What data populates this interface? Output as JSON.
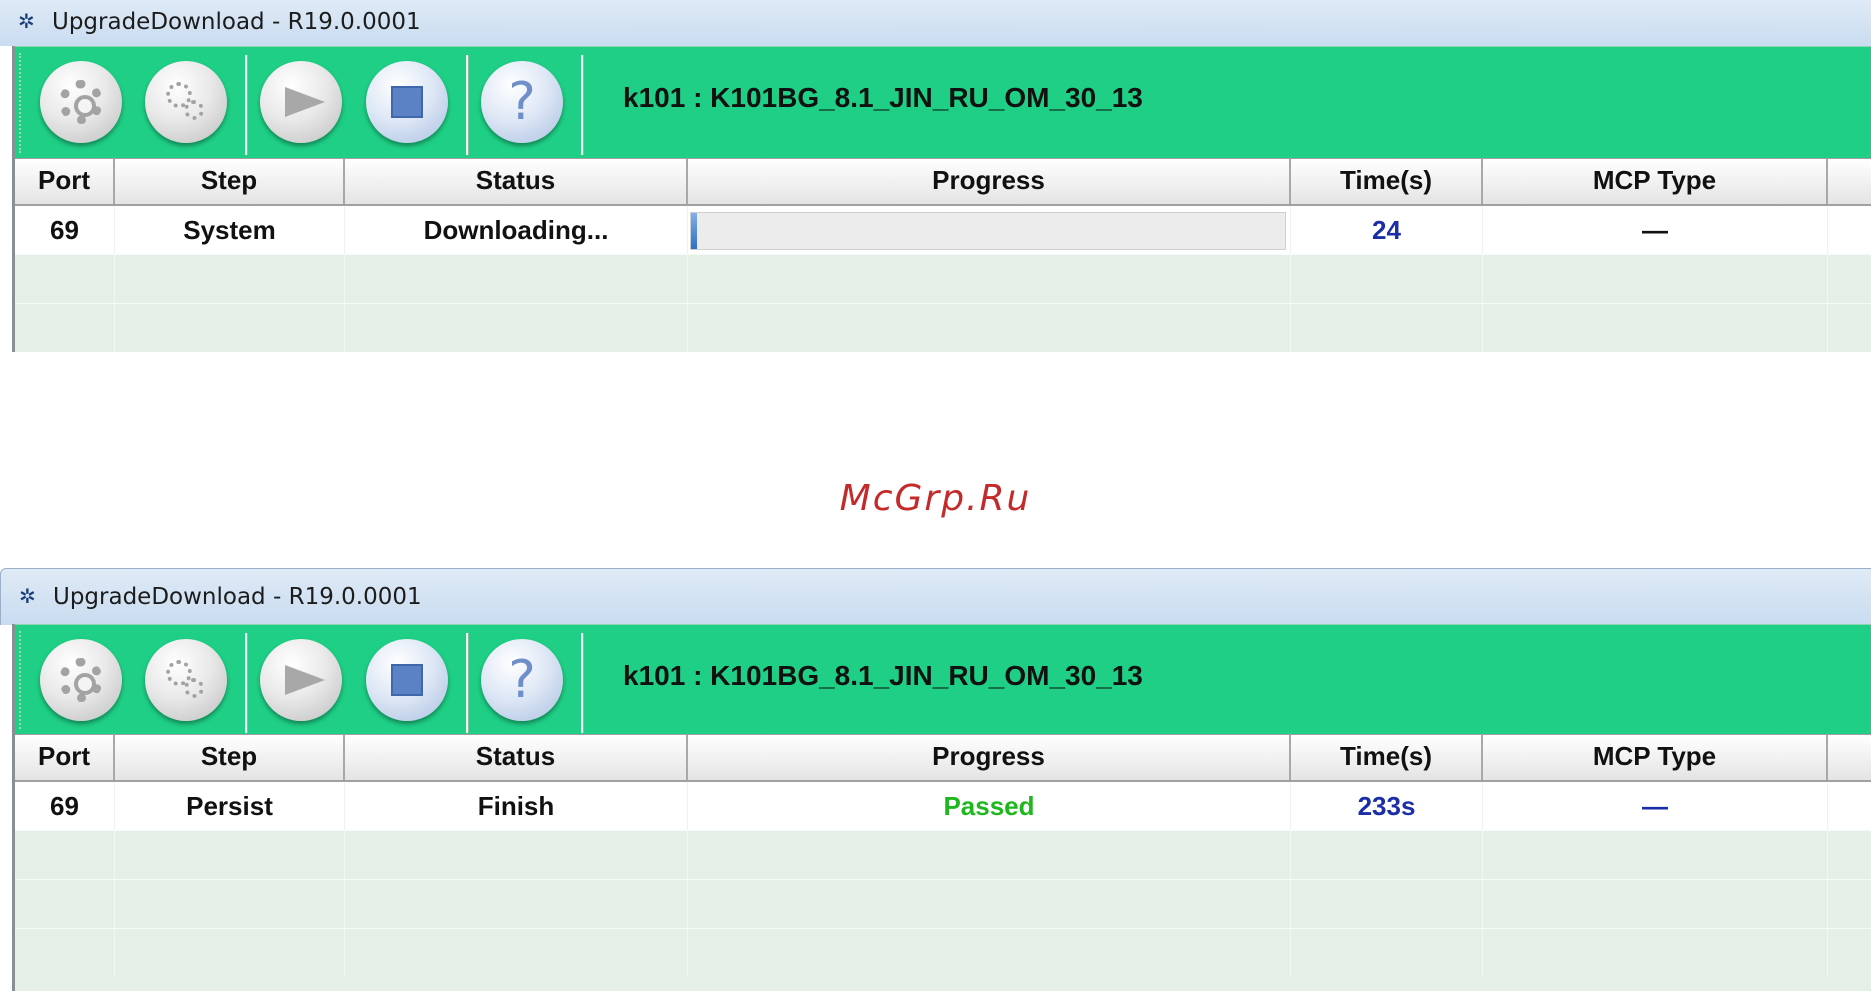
{
  "watermark": "McGrp.Ru",
  "windows": [
    {
      "title": "UpgradeDownload - R19.0.0001",
      "toolbar_title": "k101 : K101BG_8.1_JIN_RU_OM_30_13",
      "toolbar_icons": [
        "settings-gear-icon",
        "advanced-gears-icon",
        "start-arrow-icon",
        "stop-icon",
        "help-icon"
      ],
      "columns": [
        "Port",
        "Step",
        "Status",
        "Progress",
        "Time(s)",
        "MCP Type"
      ],
      "row": {
        "port": "69",
        "step": "System",
        "status": "Downloading...",
        "progress_fraction": 0.01,
        "time": "24",
        "mcp_type": "—"
      }
    },
    {
      "title": "UpgradeDownload - R19.0.0001",
      "toolbar_title": "k101 : K101BG_8.1_JIN_RU_OM_30_13",
      "toolbar_icons": [
        "settings-gear-icon",
        "advanced-gears-icon",
        "start-arrow-icon",
        "stop-icon",
        "help-icon"
      ],
      "columns": [
        "Port",
        "Step",
        "Status",
        "Progress",
        "Time(s)",
        "MCP Type"
      ],
      "row": {
        "port": "69",
        "step": "Persist",
        "status": "Finish",
        "progress_text": "Passed",
        "time": "233s",
        "mcp_type": "—"
      }
    }
  ],
  "colors": {
    "toolbar_bg": "#1ecf85",
    "time_text": "#1a2ea8",
    "passed_text": "#1eb81e",
    "watermark": "#c42a2a"
  }
}
